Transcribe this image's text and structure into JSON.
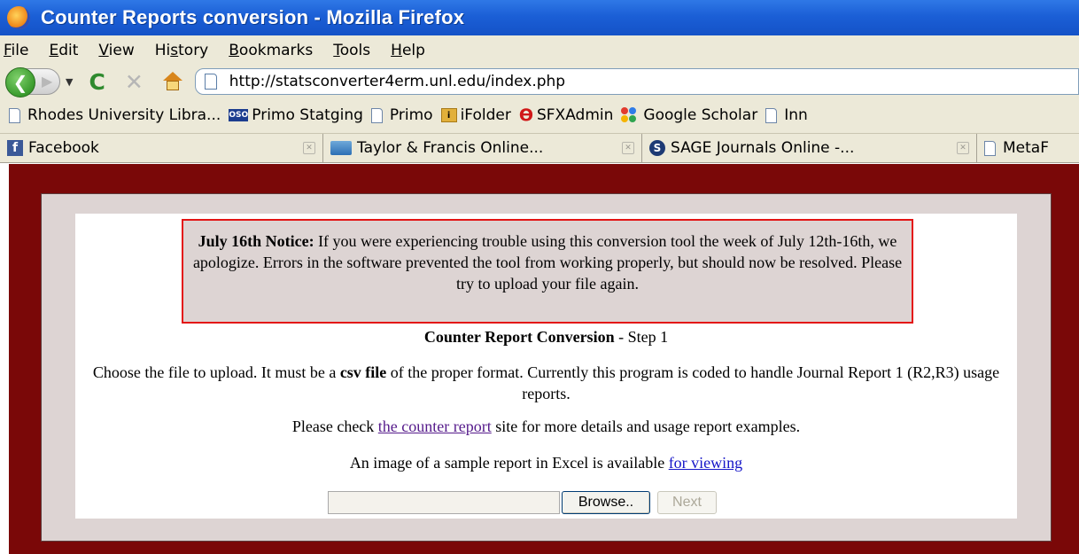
{
  "window": {
    "title": "Counter Reports conversion - Mozilla Firefox"
  },
  "menu": {
    "items": [
      {
        "ul": "F",
        "rest": "ile"
      },
      {
        "ul": "E",
        "rest": "dit"
      },
      {
        "ul": "V",
        "rest": "iew"
      },
      {
        "pre": "Hi",
        "ul": "s",
        "rest": "tory"
      },
      {
        "ul": "B",
        "rest": "ookmarks"
      },
      {
        "ul": "T",
        "rest": "ools"
      },
      {
        "ul": "H",
        "rest": "elp"
      }
    ]
  },
  "nav": {
    "url": "http://statsconverter4erm.unl.edu/index.php"
  },
  "bookmarks": [
    {
      "label": "Rhodes University Libra..."
    },
    {
      "label": "Primo Statging"
    },
    {
      "label": "Primo"
    },
    {
      "label": "iFolder"
    },
    {
      "label": "SFXAdmin"
    },
    {
      "label": "Google Scholar"
    },
    {
      "label": "Inn"
    }
  ],
  "tabs": [
    {
      "label": "Facebook"
    },
    {
      "label": "Taylor & Francis Online..."
    },
    {
      "label": "SAGE Journals Online -..."
    },
    {
      "label": "MetaF"
    }
  ],
  "page": {
    "notice": {
      "heading": "July 16th Notice:",
      "body": " If you were experiencing trouble using this conversion tool the week of July 12th-16th, we apologize. Errors in the software prevented the tool from working properly, but should now be resolved. Please try to upload your file again."
    },
    "step": {
      "title": "Counter Report Conversion",
      "suffix": " - Step 1"
    },
    "instructions": {
      "before": "Choose the file to upload. It must be a ",
      "bold": "csv file",
      "after": " of the proper format. Currently this program is coded to handle Journal Report 1 (R2,R3) usage reports."
    },
    "check": {
      "before": "Please check ",
      "link": "the counter report",
      "after": " site for more details and usage report examples."
    },
    "sample": {
      "before": "An image of a sample report in Excel is available ",
      "link": "for viewing"
    },
    "upload": {
      "file_value": "",
      "browse_label": "Browse..",
      "next_label": "Next"
    }
  },
  "colors": {
    "page_background": "#7a0808",
    "frame_background": "#ddd4d3",
    "notice_border": "#e31414",
    "visited_link": "#551a8b",
    "link": "#1515c8"
  }
}
